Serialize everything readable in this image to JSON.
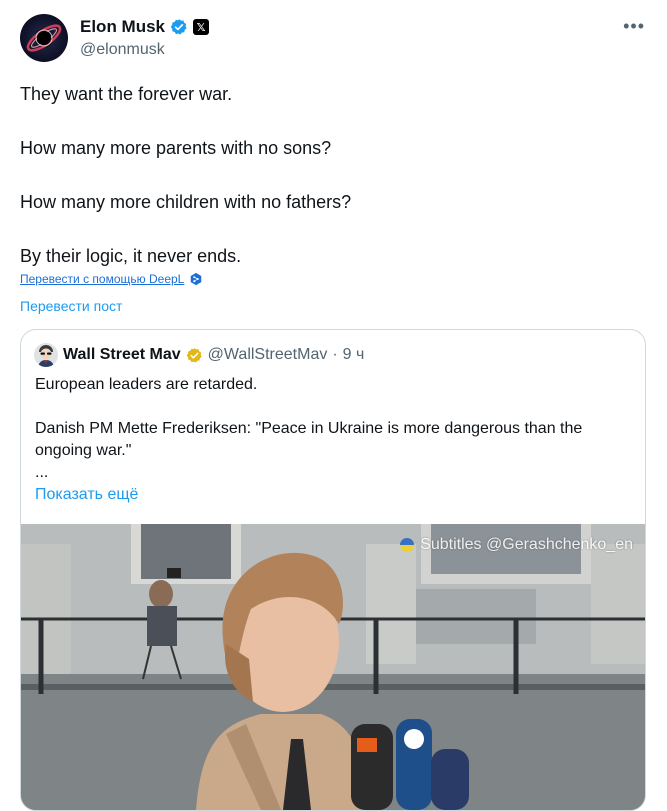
{
  "tweet": {
    "author_name": "Elon Musk",
    "author_handle": "@elonmusk",
    "more_icon": "more-horizontal-icon",
    "lines": [
      "They want the forever war.",
      "How many more parents with no sons?",
      "How many more children with no fathers?",
      "By their logic, it never ends."
    ],
    "deepl_label": "Перевести с помощью DeepL",
    "translate_label": "Перевести пост"
  },
  "quote": {
    "author_name": "Wall Street Mav",
    "author_handle": "@WallStreetMav",
    "separator": "·",
    "time": "9 ч",
    "text1": "European leaders are retarded.",
    "text2": "Danish PM Mette Frederiksen:  \"Peace in Ukraine is more dangerous than the ongoing war.\"",
    "ellipsis": "...",
    "show_more": "Показать ещё",
    "media_watermark": "Subtitles @Gerashchenko_en"
  },
  "colors": {
    "accent": "#1d9bf0",
    "verified_blue": "#1d9bf0",
    "verified_gold": "#e2b719",
    "muted": "#536471",
    "border": "#cfd9de"
  }
}
